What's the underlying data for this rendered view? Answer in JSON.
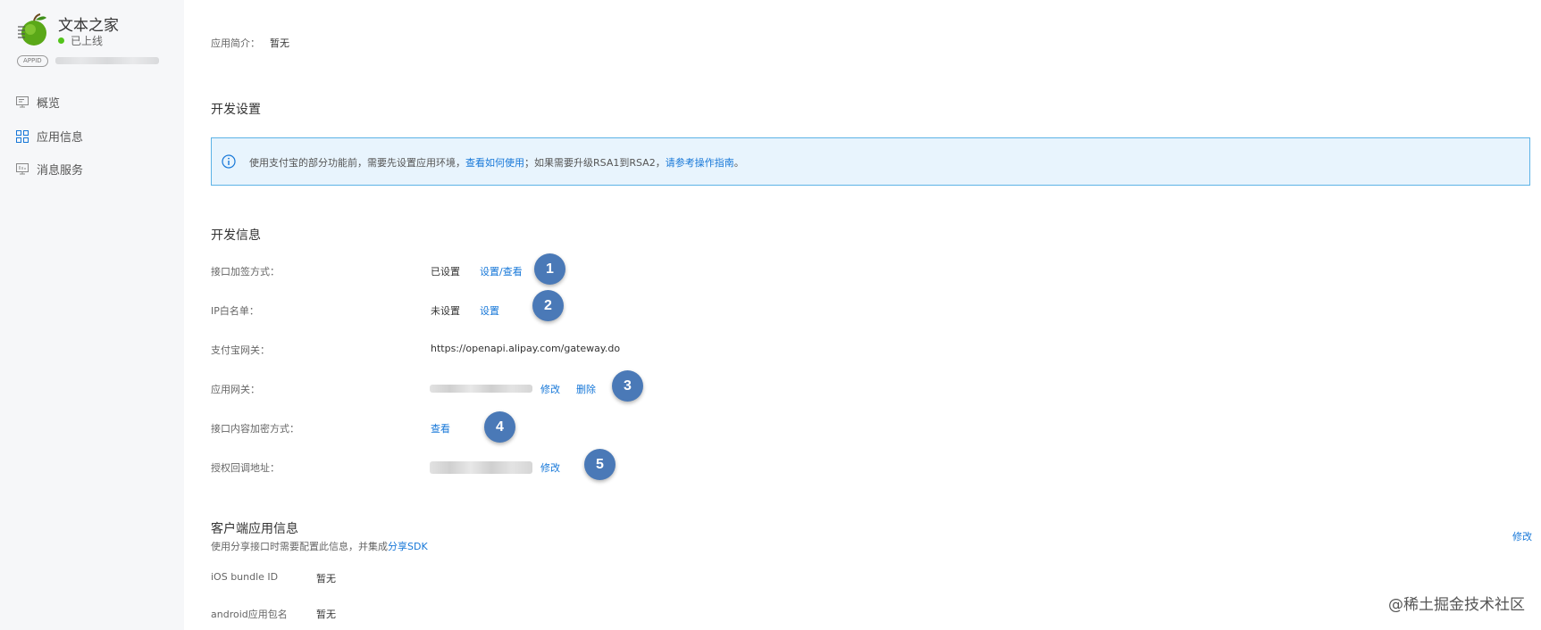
{
  "sidebar": {
    "app_name": "文本之家",
    "app_status": "已上线",
    "appid_badge": "APPID",
    "nav": [
      {
        "label": "概览",
        "icon": "monitor-icon"
      },
      {
        "label": "应用信息",
        "icon": "grid-icon"
      },
      {
        "label": "消息服务",
        "icon": "monitor-icon"
      }
    ]
  },
  "main": {
    "intro": {
      "label": "应用简介：",
      "value": "暂无"
    },
    "dev_settings_title": "开发设置",
    "notice": {
      "text1": "使用支付宝的部分功能前，需要先设置应用环境，",
      "link1": "查看如何使用",
      "text2": "；如果需要升级RSA1到RSA2，",
      "link2": "请参考操作指南",
      "text3": "。"
    },
    "dev_info_title": "开发信息",
    "rows": {
      "sign": {
        "label": "接口加签方式：",
        "value": "已设置",
        "action": "设置/查看",
        "step": "1"
      },
      "ip": {
        "label": "IP白名单：",
        "value": "未设置",
        "action": "设置",
        "step": "2"
      },
      "gateway": {
        "label": "支付宝网关：",
        "value": "https://openapi.alipay.com/gateway.do"
      },
      "app_gateway": {
        "label": "应用网关：",
        "action_edit": "修改",
        "action_delete": "删除",
        "step": "3"
      },
      "encrypt": {
        "label": "接口内容加密方式：",
        "action": "查看",
        "step": "4"
      },
      "callback": {
        "label": "授权回调地址：",
        "action": "修改",
        "step": "5"
      }
    },
    "client": {
      "title": "客户端应用信息",
      "subtitle": "使用分享接口时需要配置此信息，并集成",
      "subtitle_link": "分享SDK",
      "edit": "修改",
      "ios_label": "iOS bundle ID",
      "ios_value": "暂无",
      "android_label": "android应用包名",
      "android_value": "暂无"
    }
  },
  "watermark": "@稀土掘金技术社区",
  "colors": {
    "accent": "#1677d8",
    "step": "#4a79b7",
    "notice_bg": "#e8f4fd",
    "notice_border": "#5cb3e6",
    "online": "#52c41a"
  }
}
